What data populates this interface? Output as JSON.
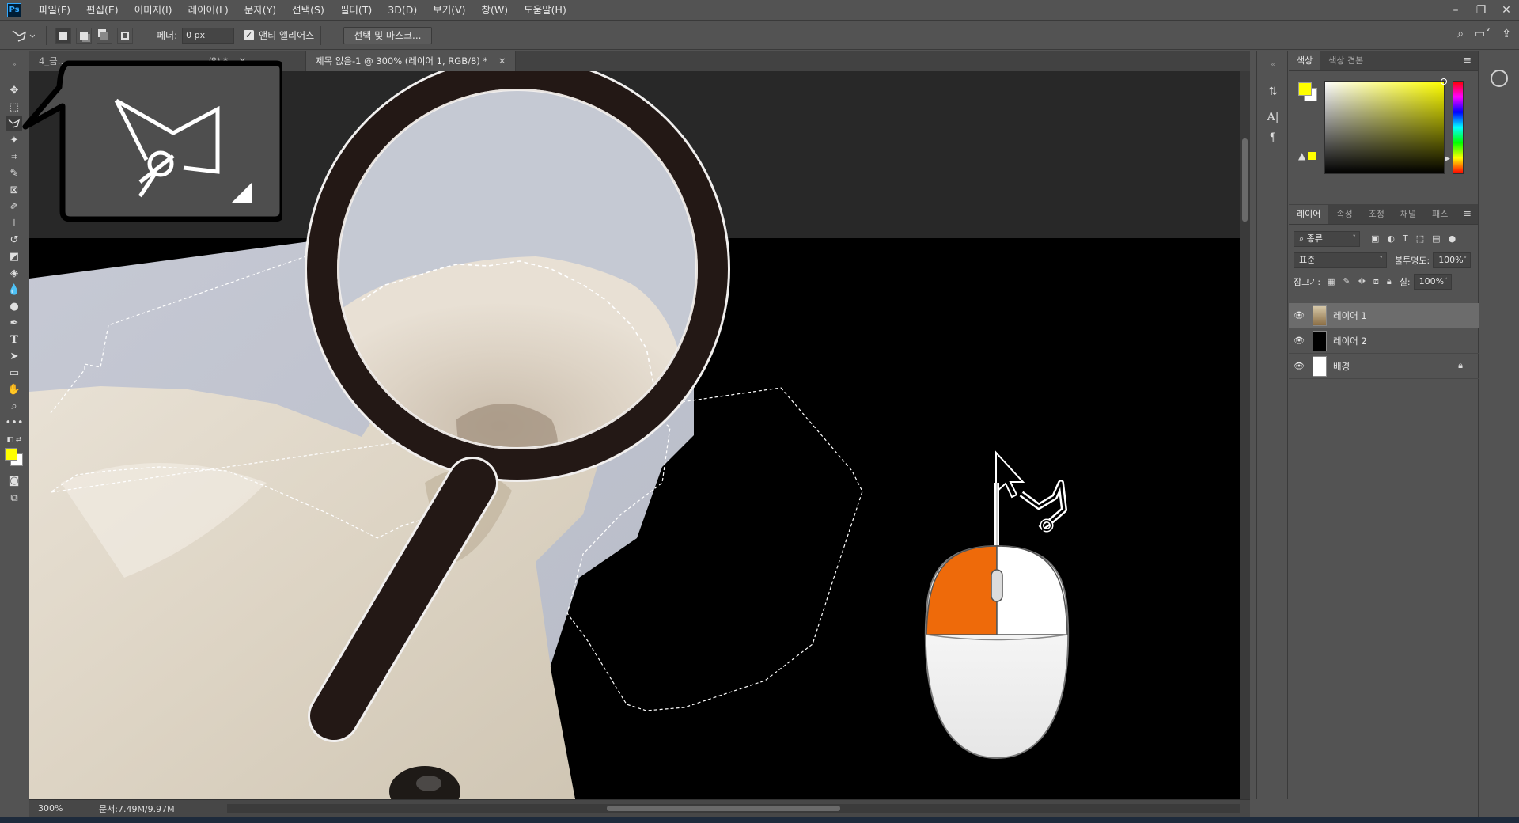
{
  "menubar": {
    "logo": "Ps",
    "items": [
      "파일(F)",
      "편집(E)",
      "이미지(I)",
      "레이어(L)",
      "문자(Y)",
      "선택(S)",
      "필터(T)",
      "3D(D)",
      "보기(V)",
      "창(W)",
      "도움말(H)"
    ]
  },
  "options": {
    "feather_label": "페더:",
    "feather_value": "0 px",
    "antialias_label": "앤티 앨리어스",
    "select_mask_label": "선택 및 마스크..."
  },
  "tabs": [
    {
      "label": "4_금…",
      "active": false
    },
    {
      "label": "제목 없음-1 @ 300% (레이어 1, RGB/8) *",
      "active": true
    }
  ],
  "tab_partial_suffix": "/8) *",
  "status": {
    "zoom": "300%",
    "doc_size": "문서:7.49M/9.97M"
  },
  "color_panel": {
    "tabs": [
      "색상",
      "색상 견본"
    ],
    "foreground": "#ffff00",
    "background": "#ffffff"
  },
  "layers_panel": {
    "tabs": [
      "레이어",
      "속성",
      "조정",
      "채널",
      "패스"
    ],
    "filter_kind": "종류",
    "blend_mode": "표준",
    "opacity_label": "불투명도:",
    "opacity_value": "100%",
    "lock_label": "잠그기:",
    "fill_label": "칠:",
    "fill_value": "100%",
    "layers": [
      {
        "name": "레이어 1",
        "selected": true,
        "locked": false
      },
      {
        "name": "레이어 2",
        "selected": false,
        "locked": false
      },
      {
        "name": "배경",
        "selected": false,
        "locked": true
      }
    ]
  },
  "icons": {
    "active_tool": "polygonal-lasso-icon",
    "callout_tool": "polygonal-lasso-icon"
  },
  "colors": {
    "mouse_left_button": "#ee6a0a",
    "magnifier_frame": "#231815"
  }
}
